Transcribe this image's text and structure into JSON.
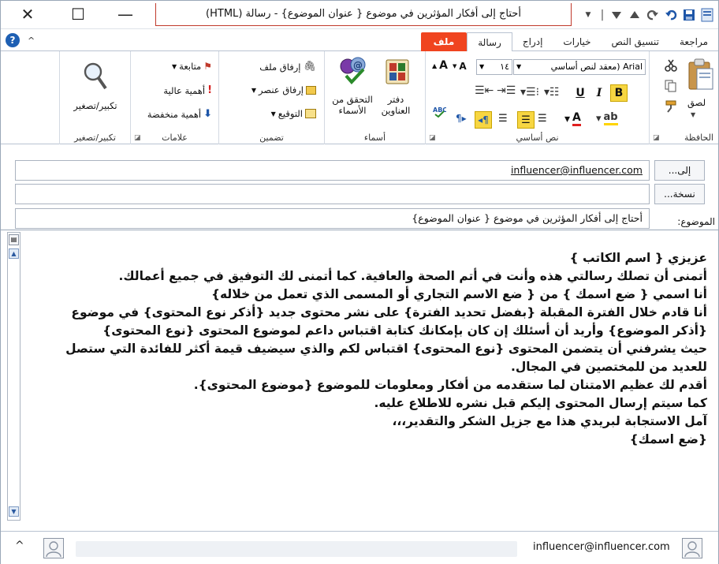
{
  "window": {
    "title": "أحتاج إلى أفكار المؤثرين في موضوع { عنوان الموضوع} - رسالة (HTML)",
    "close_glyph": "✕",
    "maximize_glyph": "☐",
    "minimize_glyph": "—"
  },
  "qat": {
    "separator": "|",
    "dropdown_glyph": "▼"
  },
  "tabs": [
    {
      "label": "ملف"
    },
    {
      "label": "رسالة"
    },
    {
      "label": "إدراج"
    },
    {
      "label": "خيارات"
    },
    {
      "label": "تنسيق النص"
    },
    {
      "label": "مراجعة"
    }
  ],
  "ribbon": {
    "clipboard": {
      "paste": "لصق",
      "label": "الحافظة"
    },
    "basic_text": {
      "font_name": "Arial (معقد لنص أساسي",
      "font_size": "١٤",
      "label": "نص أساسي"
    },
    "names": {
      "address_book": "دفتر العناوين",
      "check_names": "التحقق من الأسماء",
      "label": "أسماء"
    },
    "include": {
      "attach_file": "إرفاق ملف",
      "attach_item": "إرفاق عنصر",
      "signature": "التوقيع",
      "label": "تضمين"
    },
    "tags": {
      "follow_up": "متابعة",
      "high_importance": "أهمية عالية",
      "low_importance": "أهمية منخفضة",
      "label": "علامات"
    },
    "zoom": {
      "zoom": "تكبير/تصغير",
      "label": "تكبير/تصغير"
    }
  },
  "header": {
    "to_button": "إلى...",
    "to_value": "influencer@influencer.com",
    "cc_button": "نسخة...",
    "cc_value": "",
    "subject_label": "الموضوع:",
    "subject_value": "أحتاج إلى أفكار المؤثرين في موضوع { عنوان الموضوع}"
  },
  "body": {
    "lines": [
      "عزيزي { اسم الكاتب }",
      "أتمنى أن تصلك رسالتي هذه وأنت في أتم الصحة والعافية. كما أتمنى لك التوفيق في جميع أعمالك.",
      "أنا اسمي { ضع اسمك } من { ضع الاسم التجاري أو المسمى الذي تعمل من خلاله}",
      "أنا قادم خلال الفترة المقبلة {بفضل تحديد الفترة} على نشر محتوى جديد {أذكر نوع المحتوى} في موضوع {أذكر الموضوع} وأريد أن أسئلك إن كان بإمكانك كتابة اقتباس داعم لموضوع المحتوى {نوع المحتوى}",
      "حيث يشرفني أن يتضمن المحتوى {نوع المحتوى} اقتباس لكم والذي سيضيف قيمة أكثر للفائدة التي ستصل للعديد من للمختصين في المجال.",
      "أقدم لك عظيم الامتنان لما  ستقدمه من أفكار ومعلومات للموضوع {موضوع المحتوى}.",
      "كما سيتم إرسال المحتوى إليكم قبل نشره للاطلاع عليه.",
      "آمل الاستجابة لبريدي هذا مع جزيل الشكر والتقدير،،،",
      "{ضع اسمك}"
    ]
  },
  "people_pane": {
    "email": "influencer@influencer.com",
    "expand_glyph": "^"
  }
}
